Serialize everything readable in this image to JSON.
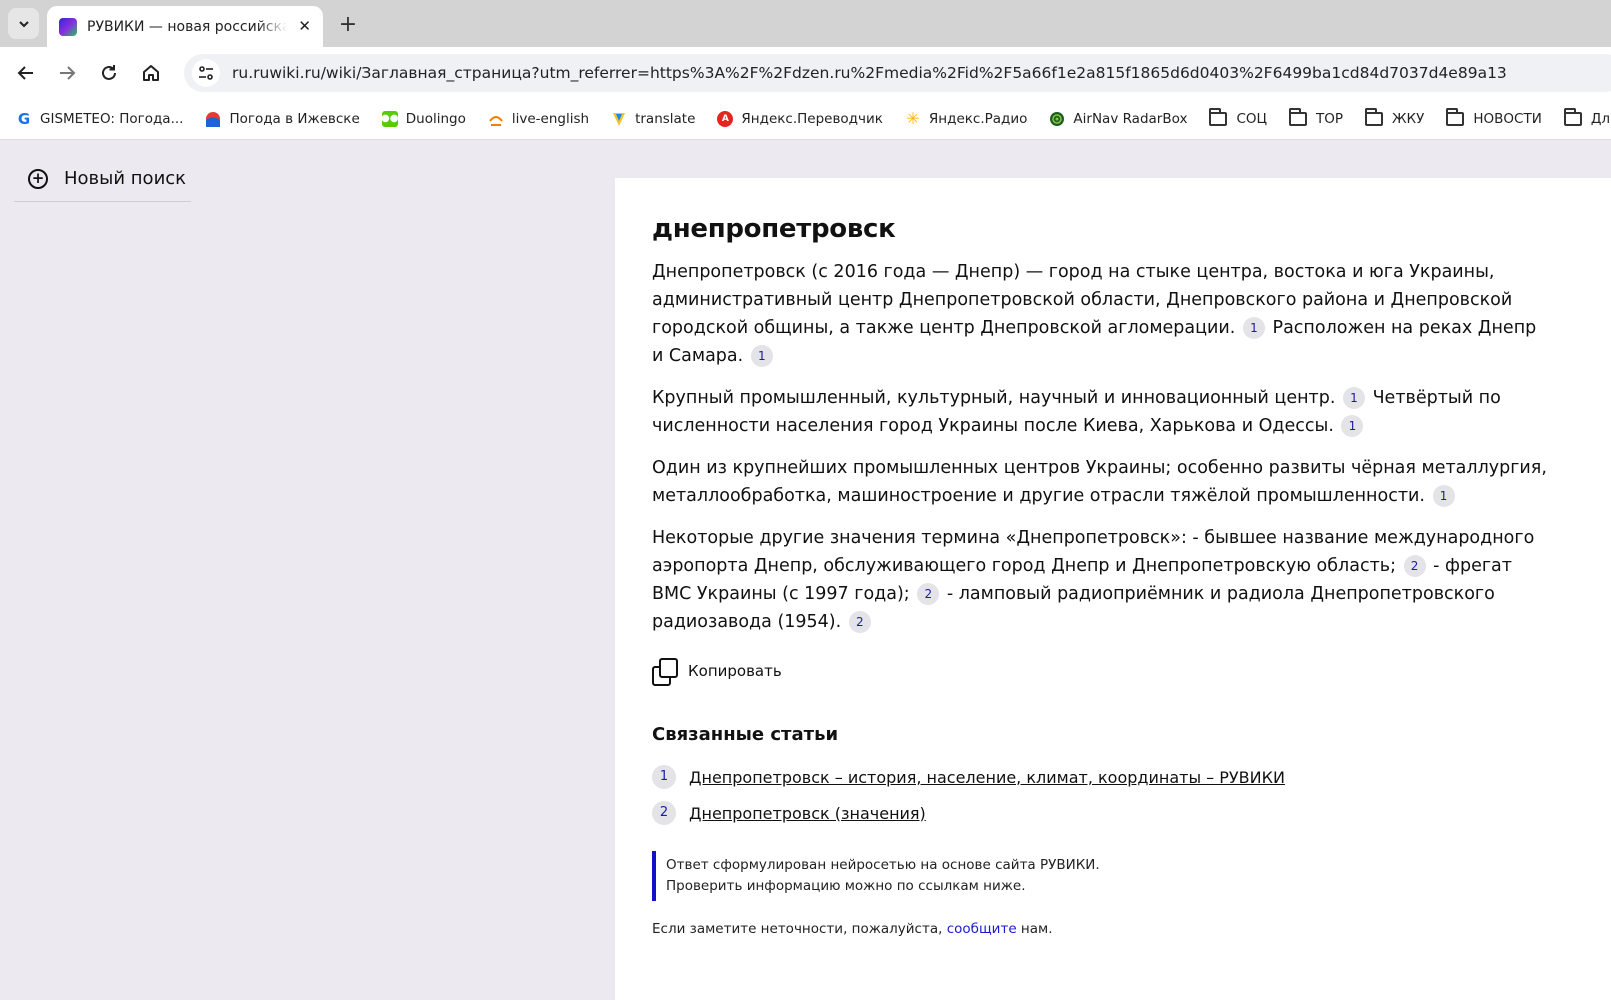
{
  "browser": {
    "tab_title": "РУВИКИ — новая российская",
    "tab_close": "✕",
    "new_tab": "+",
    "url": "ru.ruwiki.ru/wiki/Заглавная_страница?utm_referrer=https%3A%2F%2Fdzen.ru%2Fmedia%2Fid%2F5a66f1e2a815f1865d6d0403%2F6499ba1cd84d7037d4e89a13",
    "bookmarks": [
      {
        "label": "GISMETEO: Погода...",
        "icon": "gismeteo-icon"
      },
      {
        "label": "Погода в Ижевске",
        "icon": "weather-icon"
      },
      {
        "label": "Duolingo",
        "icon": "duolingo-icon"
      },
      {
        "label": "live-english",
        "icon": "live-english-icon"
      },
      {
        "label": "translate",
        "icon": "translate-icon"
      },
      {
        "label": "Яндекс.Переводчик",
        "icon": "yandex-translator-icon"
      },
      {
        "label": "Яндекс.Радио",
        "icon": "yandex-radio-icon"
      },
      {
        "label": "AirNav RadarBox",
        "icon": "radarbox-icon"
      }
    ],
    "bookmark_folders": [
      "СОЦ",
      "TOP",
      "ЖКУ",
      "НОВОСТИ",
      "Для"
    ]
  },
  "sidebar": {
    "new_search_label": "Новый поиск"
  },
  "article": {
    "title": "днепропетровск",
    "paragraphs": [
      {
        "parts": [
          {
            "text": "Днепропетровск (с 2016 года — Днепр) — город на стыке центра, востока и юга Украины, административный центр Днепропетровской области, Днепровского района и Днепровской городской общины, а также центр Днепровской агломерации."
          },
          {
            "cite": "1"
          },
          {
            "text": " Расположен на реках Днепр и Самара."
          },
          {
            "cite": "1"
          }
        ]
      },
      {
        "parts": [
          {
            "text": "Крупный промышленный, культурный, научный и инновационный центр."
          },
          {
            "cite": "1"
          },
          {
            "text": " Четвёртый по численности населения город Украины после Киева, Харькова и Одессы."
          },
          {
            "cite": "1"
          }
        ]
      },
      {
        "parts": [
          {
            "text": "Один из крупнейших промышленных центров Украины; особенно развиты чёрная металлургия, металлообработка, машиностроение и другие отрасли тяжёлой промышленности."
          },
          {
            "cite": "1"
          }
        ]
      },
      {
        "parts": [
          {
            "text": "Некоторые другие значения термина «Днепропетровск»: - бывшее название международного аэропорта Днепр, обслуживающего город Днепр и Днепропетровскую область;"
          },
          {
            "cite": "2"
          },
          {
            "text": " - фрегат ВМС Украины (с 1997 года);"
          },
          {
            "cite": "2"
          },
          {
            "text": " - ламповый радиоприёмник и радиола Днепропетровского радиозавода (1954)."
          },
          {
            "cite": "2"
          }
        ]
      }
    ],
    "copy_label": "Копировать",
    "related_title": "Связанные статьи",
    "related": [
      {
        "num": "1",
        "label": "Днепропетровск – история, население, климат, координаты – РУВИКИ"
      },
      {
        "num": "2",
        "label": "Днепропетровск (значения)"
      }
    ],
    "notice_line1": "Ответ сформулирован нейросетью на основе сайта РУВИКИ.",
    "notice_line2": "Проверить информацию можно по ссылкам ниже.",
    "report_prefix": "Если заметите неточности, пожалуйста, ",
    "report_link": "сообщите",
    "report_suffix": " нам."
  }
}
